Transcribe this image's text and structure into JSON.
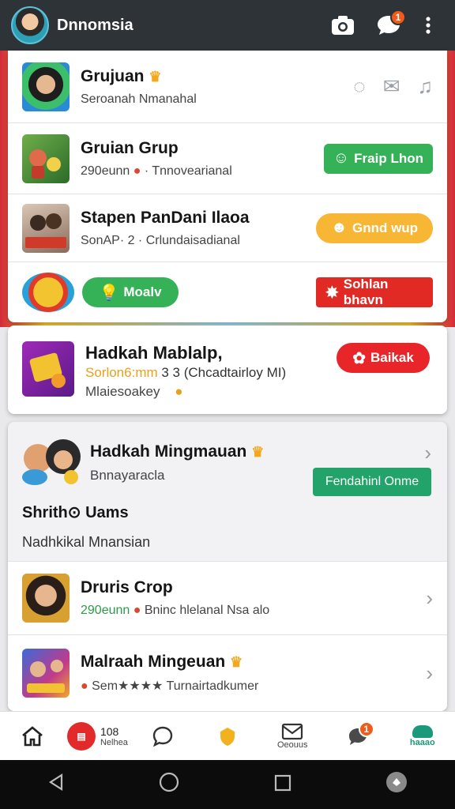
{
  "header": {
    "title": "Dnnomsia",
    "notif_count": "1"
  },
  "rows": [
    {
      "title": "Grujuan",
      "sub": "Seroanah Nmanahal"
    },
    {
      "title": "Gruian Grup",
      "sub_green": "290eunn",
      "sub": "· Tnnovearianal",
      "button": "Fraip Lhon"
    },
    {
      "title": "Stapen PanDani Ilaoa",
      "sub": "SonAP· 2 · Crlundaisadianal",
      "button": "Gnnd wup"
    },
    {
      "button_left": "Moalv",
      "button_right": "Sohlan bhavn"
    }
  ],
  "featured": {
    "title": "Hadkah Mablalp,",
    "sub1_orange": "Sorlon6:mm",
    "sub1": "3 3 (Chcadtairloy MI)",
    "sub2": "Mlaiesoakey",
    "button": "Baikak"
  },
  "group": {
    "title": "Hadkah Mingmauan",
    "sub": "Bnnayaracla",
    "button": "Fendahinl Onme",
    "section_title": "Shrith⊙ Uams",
    "section_sub": "Nadhkikal Mnansian"
  },
  "list": [
    {
      "title": "Druris Crop",
      "sub_green": "290eunn",
      "sub": "Bninc hlelanal Nsa alo"
    },
    {
      "title": "Malraah Mingeuan",
      "sub": "Sem★★★★ Turnairtadkumer"
    }
  ],
  "nav": {
    "item2_number": "108",
    "item2_label": "Nelhea",
    "item5_label": "Oeouus",
    "item6_count": "1",
    "item7_label": "haaao"
  }
}
